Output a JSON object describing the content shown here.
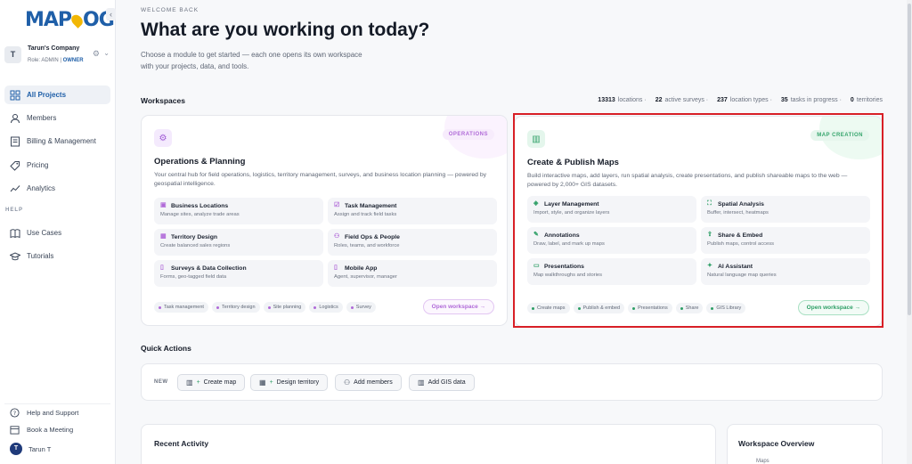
{
  "brand": {
    "logo_text_1": "MAP",
    "logo_text_2": "OG"
  },
  "company": {
    "avatar": "T",
    "name": "Tarun's Company",
    "role": "Role: ADMIN |",
    "owner": "OWNER"
  },
  "sidebar": {
    "items": [
      {
        "label": "All Projects",
        "icon": "grid-icon"
      },
      {
        "label": "Members",
        "icon": "user-icon"
      },
      {
        "label": "Billing & Management",
        "icon": "billing-icon"
      },
      {
        "label": "Pricing",
        "icon": "tag-icon"
      },
      {
        "label": "Analytics",
        "icon": "analytics-icon"
      }
    ],
    "help_label": "HELP",
    "help_items": [
      {
        "label": "Use Cases",
        "icon": "book-icon"
      },
      {
        "label": "Tutorials",
        "icon": "graduation-icon"
      }
    ],
    "bottom": {
      "support": "Help and Support",
      "meeting": "Book a Meeting",
      "user_initial": "T",
      "user_name": "Tarun T"
    }
  },
  "header": {
    "welcome": "WELCOME BACK",
    "title": "What are you working on today?",
    "subtitle": "Choose a module to get started — each one opens its own workspace with your projects, data, and tools."
  },
  "workspaces": {
    "heading": "Workspaces",
    "stats": [
      {
        "value": "13313",
        "label": "locations"
      },
      {
        "value": "22",
        "label": "active surveys"
      },
      {
        "value": "237",
        "label": "location types"
      },
      {
        "value": "35",
        "label": "tasks in progress"
      },
      {
        "value": "0",
        "label": "territories"
      }
    ],
    "ops": {
      "badge": "OPERATIONS",
      "title": "Operations & Planning",
      "desc": "Your central hub for field operations, logistics, territory management, surveys, and business location planning — powered by geospatial intelligence.",
      "features": [
        {
          "title": "Business Locations",
          "desc": "Manage sites, analyze trade areas"
        },
        {
          "title": "Task Management",
          "desc": "Assign and track field tasks"
        },
        {
          "title": "Territory Design",
          "desc": "Create balanced sales regions"
        },
        {
          "title": "Field Ops & People",
          "desc": "Roles, teams, and workforce"
        },
        {
          "title": "Surveys & Data Collection",
          "desc": "Forms, geo-tagged field data"
        },
        {
          "title": "Mobile App",
          "desc": "Agent, supervisor, manager"
        }
      ],
      "tags": [
        "Task management",
        "Territory design",
        "Site planning",
        "Logistics",
        "Survey"
      ],
      "open": "Open workspace →"
    },
    "maps": {
      "badge": "MAP CREATION",
      "title": "Create & Publish Maps",
      "desc": "Build interactive maps, add layers, run spatial analysis, create presentations, and publish shareable maps to the web — powered by 2,000+ GIS datasets.",
      "features": [
        {
          "title": "Layer Management",
          "desc": "Import, style, and organize layers"
        },
        {
          "title": "Spatial Analysis",
          "desc": "Buffer, intersect, heatmaps"
        },
        {
          "title": "Annotations",
          "desc": "Draw, label, and mark up maps"
        },
        {
          "title": "Share & Embed",
          "desc": "Publish maps, control access"
        },
        {
          "title": "Presentations",
          "desc": "Map walkthroughs and stories"
        },
        {
          "title": "AI Assistant",
          "desc": "Natural language map queries"
        }
      ],
      "tags": [
        "Create maps",
        "Publish & embed",
        "Presentations",
        "Share",
        "GIS Library"
      ],
      "open": "Open workspace →"
    }
  },
  "quick_actions": {
    "heading": "Quick Actions",
    "new_label": "NEW",
    "buttons": [
      {
        "label": "Create map",
        "icon": "map-icon"
      },
      {
        "label": "Design territory",
        "icon": "grid-icon"
      },
      {
        "label": "Add members",
        "icon": "users-icon"
      },
      {
        "label": "Add GIS data",
        "icon": "map-icon"
      }
    ]
  },
  "recent": {
    "title": "Recent Activity"
  },
  "overview": {
    "title": "Workspace Overview",
    "sub": "Maps"
  }
}
